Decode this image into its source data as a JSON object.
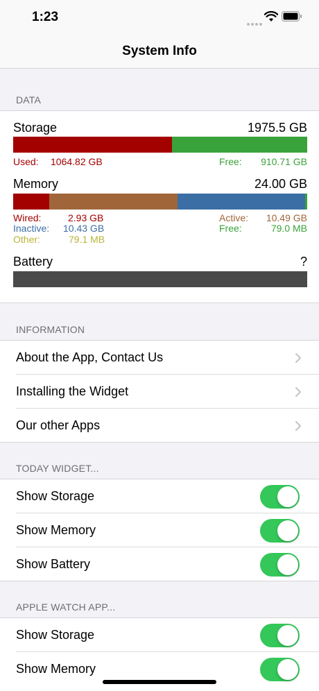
{
  "status_bar": {
    "time": "1:23"
  },
  "nav": {
    "title": "System Info"
  },
  "data_section": {
    "header": "DATA",
    "storage": {
      "label": "Storage",
      "total": "1975.5 GB",
      "used_label": "Used:",
      "used_value": "1064.82 GB",
      "used_fraction": 0.539,
      "free_label": "Free:",
      "free_value": "910.71 GB",
      "colors": {
        "used": "#a30000",
        "free": "#3aa23a"
      }
    },
    "memory": {
      "label": "Memory",
      "total": "24.00 GB",
      "wired_label": "Wired:",
      "wired_value": "2.93 GB",
      "active_label": "Active:",
      "active_value": "10.49 GB",
      "inactive_label": "Inactive:",
      "inactive_value": "10.43 GB",
      "free_label": "Free:",
      "free_value": "79.0 MB",
      "other_label": "Other:",
      "other_value": "79.1 MB",
      "segments_gb": {
        "wired": 2.93,
        "active": 10.49,
        "inactive": 10.43,
        "free": 0.079
      },
      "colors": {
        "wired": "#a30000",
        "active": "#a0663a",
        "inactive": "#3b6ea5",
        "free": "#3aa23a",
        "other": "#b9b33a"
      }
    },
    "battery": {
      "label": "Battery",
      "value": "?",
      "color": "#4a4a4a"
    }
  },
  "information_section": {
    "header": "INFORMATION",
    "items": [
      {
        "label": "About the App, Contact Us"
      },
      {
        "label": "Installing the Widget"
      },
      {
        "label": "Our other Apps"
      }
    ]
  },
  "today_widget_section": {
    "header": "TODAY WIDGET...",
    "items": [
      {
        "label": "Show Storage",
        "on": true
      },
      {
        "label": "Show Memory",
        "on": true
      },
      {
        "label": "Show Battery",
        "on": true
      }
    ]
  },
  "apple_watch_section": {
    "header": "APPLE WATCH APP...",
    "items": [
      {
        "label": "Show Storage",
        "on": true
      },
      {
        "label": "Show Memory",
        "on": true
      }
    ]
  },
  "accent_color": "#34c759"
}
